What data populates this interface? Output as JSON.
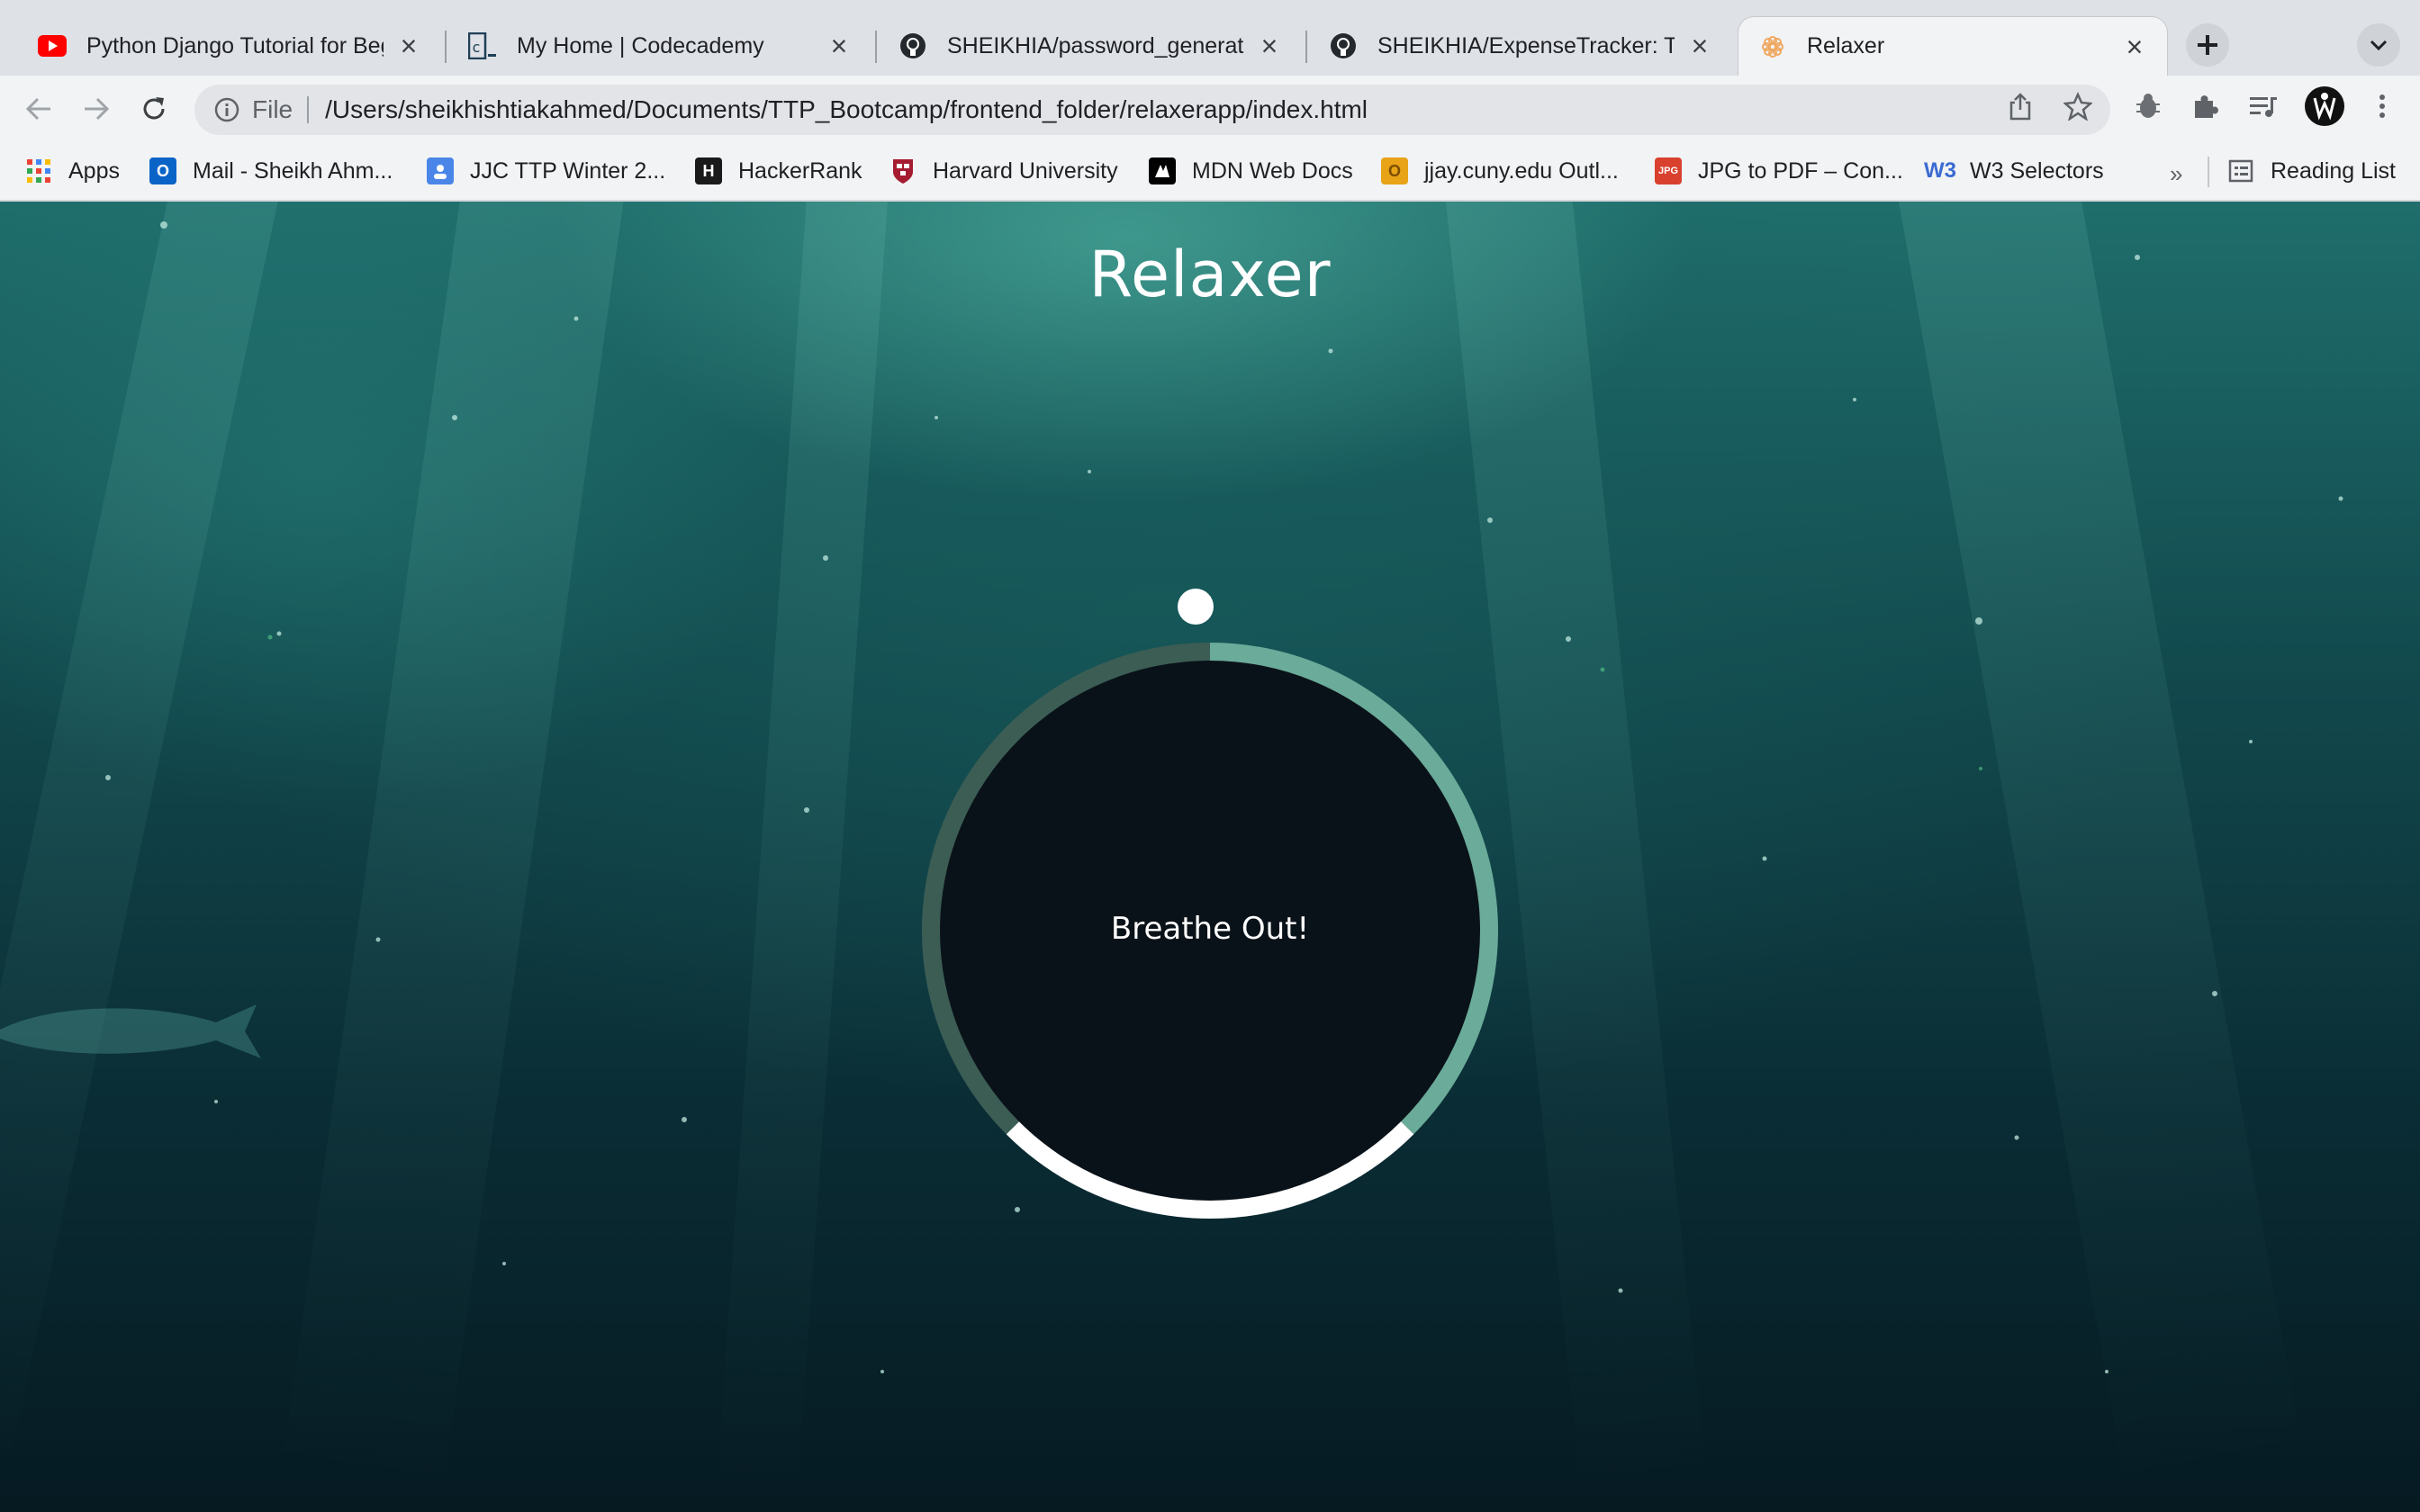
{
  "browser": {
    "tabs": [
      {
        "title": "Python Django Tutorial for Begi",
        "icon": "youtube-icon",
        "active": false
      },
      {
        "title": "My Home | Codecademy",
        "icon": "codecademy-icon",
        "active": false
      },
      {
        "title": "SHEIKHIA/password_generator",
        "icon": "github-icon",
        "active": false
      },
      {
        "title": "SHEIKHIA/ExpenseTracker: This",
        "icon": "github-icon",
        "active": false
      },
      {
        "title": "Relaxer",
        "icon": "relaxer-icon",
        "active": true
      }
    ],
    "address_bar": {
      "scheme_label": "File",
      "url": "/Users/sheikhishtiakahmed/Documents/TTP_Bootcamp/frontend_folder/relaxerapp/index.html"
    },
    "bookmarks": [
      {
        "label": "Apps",
        "icon": "apps-grid-icon"
      },
      {
        "label": "Mail - Sheikh Ahm...",
        "icon": "outlook-icon"
      },
      {
        "label": "JJC TTP Winter 2...",
        "icon": "classroom-icon"
      },
      {
        "label": "HackerRank",
        "icon": "hackerrank-icon"
      },
      {
        "label": "Harvard University",
        "icon": "harvard-icon"
      },
      {
        "label": "MDN Web Docs",
        "icon": "mdn-icon"
      },
      {
        "label": "jjay.cuny.edu Outl...",
        "icon": "outlook-o-icon"
      },
      {
        "label": "JPG to PDF – Con...",
        "icon": "jpg-pdf-icon"
      },
      {
        "label": "W3 Selectors",
        "icon": "w3-icon"
      }
    ],
    "bookmarks_overflow": "»",
    "reading_list": "Reading List"
  },
  "app": {
    "title": "Relaxer",
    "status": "Breathe Out!"
  },
  "colors": {
    "ring_hold": "#ffffff",
    "ring_breathe_in": "#6aab99",
    "ring_breathe_out": "#3c5d54",
    "inner_circle": "#0a1219"
  }
}
